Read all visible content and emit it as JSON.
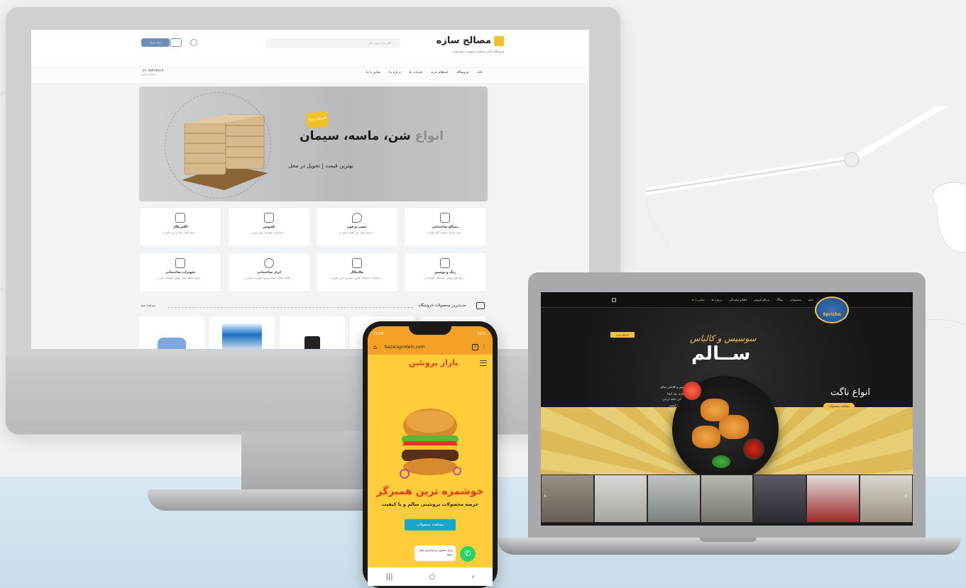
{
  "monitor_site": {
    "logo_text": "مصالح سازه",
    "logo_subtitle": "فروشگاه آنلاین مصالح و تجهیزات ساختمانی",
    "search_placeholder": "کلید واژه مورد نظر ...",
    "cart_label": "سبد خرید",
    "nav": [
      "خانه",
      "فروشگاه",
      "استعلام خرید",
      "خدمات ما",
      "درباره ما",
      "تماس با ما"
    ],
    "phone": "۰۲۱ ۷۷۴۶۴۹۱۳",
    "phone_caption": "با تماس بگیرید",
    "hero": {
      "title_gray": "انواع",
      "title_main": "شن، ماسه، سیمان",
      "badge": "فروش ویژه",
      "subtitle": "بهترین قیمت | تحویل در محل"
    },
    "categories": [
      {
        "title": "مصالح ساختمانی",
        "desc": "شن، ماسه، سیمان، گچ، بلوک و..."
      },
      {
        "title": "چسب و فوم",
        "desc": "چسب آهن، بتن، کاشی‌چسب و ..."
      },
      {
        "title": "کفپوش",
        "desc": "سرامیک، موزاییک، وال، بتن و ..."
      },
      {
        "title": "الکتریکال",
        "desc": "سیم، کابل، کلید و پریز، فیوز و ..."
      },
      {
        "title": "رنگ و پوشش",
        "desc": "رنگ های روغنی، پلاستیک، اکریلیک و..."
      },
      {
        "title": "مکانیکال",
        "desc": "شیرآلات، اتصالات فلزی، پلیمری، ابزار دقیق و ..."
      },
      {
        "title": "ابزار ساختمانی",
        "desc": "کلنگ، کلنگ، صفحه برش، تجهیزات ایمنی و ..."
      },
      {
        "title": "تجهیزات ساختمانی",
        "desc": "انواع دستگاه های جوش، لیفتراک، فرز و ..."
      }
    ],
    "section_title": "جدیدترین محصولات فروشگاه",
    "section_more": "مشاهده همه"
  },
  "laptop_site": {
    "logo": "Spricho",
    "nav": [
      "خانه",
      "محصولات",
      "وبلاگ",
      "مراکز فروش",
      "اطلاع سایندگی",
      "درباره ما",
      "تماس با ما"
    ],
    "tag": "فروش ویژه",
    "headline_top": "سوسیس و کالباس",
    "headline_main": "ســالم",
    "right_title": "انواع ناگت",
    "right_button": "مشاهده محصولات",
    "bullets": [
      "طعم واقعی سوسیس و کالباس سالم",
      "تولید شده با تکنولوژی روز اروپا",
      "طراحی شده بر اساس ذائقه ایرانی",
      "استفاده از مواد اولیه با کیفیت"
    ]
  },
  "phone_site": {
    "time": "11:05",
    "status_right": "52%",
    "url": "bazaraprotein.com",
    "logo": "بازار پروتئین",
    "title": "خوشمزه ترین همبرگر",
    "subtitle": "عرضه محصولات پروتئینی سالم و با کیفیت",
    "button": "مشاهده محصولات",
    "chat_text": "برای مشاوره و سفارش پیام بدهید"
  },
  "colors": {
    "accent_yellow": "#f6c02b",
    "phone_bg": "#ffcd3a",
    "phone_title": "#e1361b",
    "phone_button": "#19a4c9",
    "laptop_gold": "#f0c24a"
  }
}
